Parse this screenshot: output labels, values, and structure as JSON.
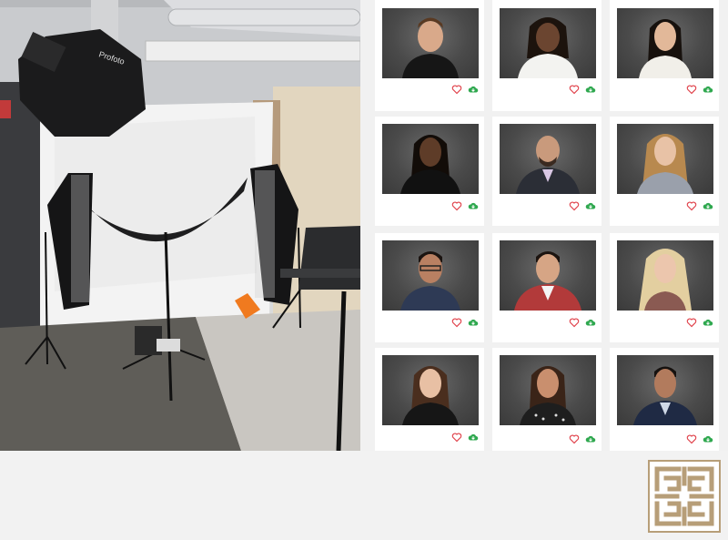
{
  "page": {
    "background": "#f1f1f1",
    "accent_heart": "#e0424b",
    "accent_download": "#2fa84f"
  },
  "studio_photo": {
    "description_icon": "photo-studio-image",
    "visible_brand_text": "Profoto"
  },
  "gallery": {
    "cards": [
      {
        "id": "1",
        "photo_icon": "headshot-portrait",
        "action_like": "heart-icon",
        "action_download": "cloud-download-icon"
      },
      {
        "id": "2",
        "photo_icon": "headshot-portrait",
        "action_like": "heart-icon",
        "action_download": "cloud-download-icon"
      },
      {
        "id": "3",
        "photo_icon": "headshot-portrait",
        "action_like": "heart-icon",
        "action_download": "cloud-download-icon"
      },
      {
        "id": "4",
        "photo_icon": "headshot-portrait",
        "action_like": "heart-icon",
        "action_download": "cloud-download-icon"
      },
      {
        "id": "5",
        "photo_icon": "headshot-portrait",
        "action_like": "heart-icon",
        "action_download": "cloud-download-icon"
      },
      {
        "id": "6",
        "photo_icon": "headshot-portrait",
        "action_like": "heart-icon",
        "action_download": "cloud-download-icon"
      },
      {
        "id": "7",
        "photo_icon": "headshot-portrait",
        "action_like": "heart-icon",
        "action_download": "cloud-download-icon"
      },
      {
        "id": "8",
        "photo_icon": "headshot-portrait",
        "action_like": "heart-icon",
        "action_download": "cloud-download-icon"
      },
      {
        "id": "9",
        "photo_icon": "headshot-portrait",
        "action_like": "heart-icon",
        "action_download": "cloud-download-icon"
      },
      {
        "id": "10",
        "photo_icon": "headshot-portrait",
        "action_like": "heart-icon",
        "action_download": "cloud-download-icon"
      },
      {
        "id": "11",
        "photo_icon": "headshot-portrait",
        "action_like": "heart-icon",
        "action_download": "cloud-download-icon"
      },
      {
        "id": "12",
        "photo_icon": "headshot-portrait",
        "action_like": "heart-icon",
        "action_download": "cloud-download-icon"
      }
    ]
  },
  "logo": {
    "icon": "greek-key-logo",
    "color": "#b79e78"
  }
}
